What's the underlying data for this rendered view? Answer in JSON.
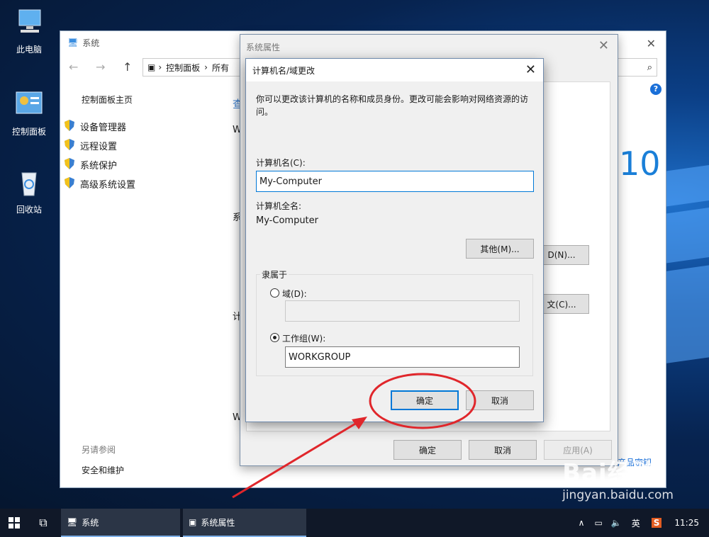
{
  "desktop": {
    "icons": [
      {
        "label": "此电脑"
      },
      {
        "label": "控制面板"
      },
      {
        "label": "回收站"
      }
    ]
  },
  "system_window": {
    "title": "系统",
    "breadcrumb": [
      "控制面板",
      "所有"
    ],
    "sidebar_home": "控制面板主页",
    "sidebar_items": [
      "设备管理器",
      "远程设置",
      "系统保护",
      "高级系统设置"
    ],
    "see_also": "另请参阅",
    "security": "安全和维护",
    "partial_texts": [
      "查",
      "W",
      "系",
      "计",
      "W"
    ],
    "win_ver": "10",
    "product_key": "产品密钥"
  },
  "sys_props": {
    "title": "系统属性",
    "id_btn": "D(N)...",
    "change_btn": "文(C)...",
    "ok": "确定",
    "cancel": "取消",
    "apply": "应用(A)"
  },
  "dialog": {
    "title": "计算机名/域更改",
    "description": "你可以更改该计算机的名称和成员身份。更改可能会影响对网络资源的访问。",
    "computer_name_label": "计算机名(C):",
    "computer_name_value": "My-Computer",
    "full_name_label": "计算机全名:",
    "full_name_value": "My-Computer",
    "more_btn": "其他(M)...",
    "member_of": "隶属于",
    "domain_label": "域(D):",
    "domain_value": "",
    "workgroup_label": "工作组(W):",
    "workgroup_value": "WORKGROUP",
    "ok": "确定",
    "cancel": "取消"
  },
  "taskbar": {
    "items": [
      "系统",
      "系统属性"
    ],
    "ime": "英",
    "time": "11:25"
  },
  "watermark": {
    "brand": "Bai经验",
    "url": "jingyan.baidu.com"
  },
  "colors": {
    "accent": "#0078d7",
    "annotation": "#e0262b"
  }
}
